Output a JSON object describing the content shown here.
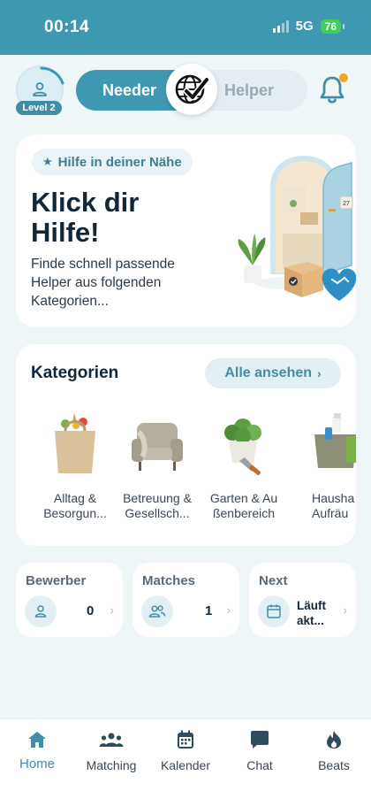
{
  "status_bar": {
    "time": "00:14",
    "network": "5G",
    "battery": "76"
  },
  "profile": {
    "level": "Level 2"
  },
  "mode_toggle": {
    "left_label": "Needer",
    "right_label": "Helper",
    "selected": "Needer"
  },
  "hero": {
    "chip": "Hilfe in deiner Nähe",
    "title": "Klick dir Hilfe!",
    "subtitle": "Finde schnell passende Helper aus folgenden Kategorien...",
    "door_number": "27"
  },
  "categories": {
    "title": "Kategorien",
    "see_all": "Alle ansehen",
    "items": [
      {
        "label": "Alltag & Besorgun...",
        "icon": "grocery-bag-icon"
      },
      {
        "label": "Betreuung & Gesellsch...",
        "icon": "armchair-icon"
      },
      {
        "label": "Garten & Au ßenbereich",
        "icon": "plant-trowel-icon"
      },
      {
        "label": "Hausha Aufräu",
        "icon": "cleaning-bucket-icon"
      }
    ]
  },
  "stats": [
    {
      "title": "Bewerber",
      "value": "0",
      "icon": "person-icon"
    },
    {
      "title": "Matches",
      "value": "1",
      "icon": "people-icon"
    },
    {
      "title": "Next",
      "value": "Läuft akt...",
      "icon": "calendar-icon"
    }
  ],
  "bottom_nav": [
    {
      "label": "Home",
      "icon": "home-icon",
      "active": true
    },
    {
      "label": "Matching",
      "icon": "group-icon",
      "active": false
    },
    {
      "label": "Kalender",
      "icon": "calendar-icon",
      "active": false
    },
    {
      "label": "Chat",
      "icon": "chat-icon",
      "active": false
    },
    {
      "label": "Beats",
      "icon": "flame-icon",
      "active": false
    }
  ],
  "colors": {
    "primary": "#3f98b1",
    "accent": "#f5a623",
    "background": "#eef6f8",
    "text": "#12263a"
  }
}
